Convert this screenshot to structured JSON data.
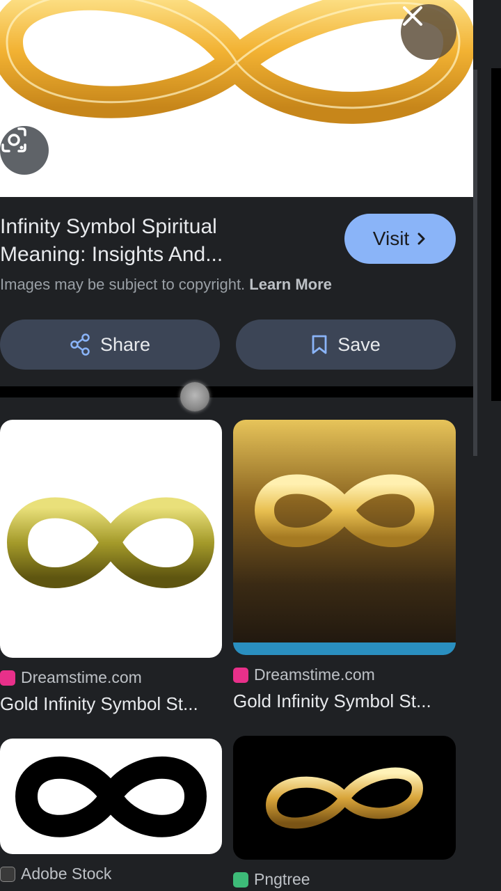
{
  "hero": {
    "close_icon": "close-icon",
    "lens_icon": "lens-icon"
  },
  "result": {
    "title_line1": "Infinity Symbol Spiritual",
    "title_line2": "Meaning: Insights And...",
    "visit_label": "Visit",
    "copyright_text": "Images may be subject to copyright.",
    "learn_more": "Learn More"
  },
  "actions": {
    "share_label": "Share",
    "save_label": "Save"
  },
  "related": [
    {
      "source": "Dreamstime.com",
      "caption": "Gold Infinity Symbol St..."
    },
    {
      "source": "Dreamstime.com",
      "caption": "Gold Infinity Symbol St..."
    },
    {
      "source": "Adobe Stock",
      "caption": ""
    },
    {
      "source": "Pngtree",
      "caption": ""
    }
  ],
  "colors": {
    "background": "#1f2124",
    "accent": "#8ab4f8",
    "button_bg": "#3c4556",
    "dreamstime": "#e8308a",
    "pngtree": "#3dbb78"
  }
}
